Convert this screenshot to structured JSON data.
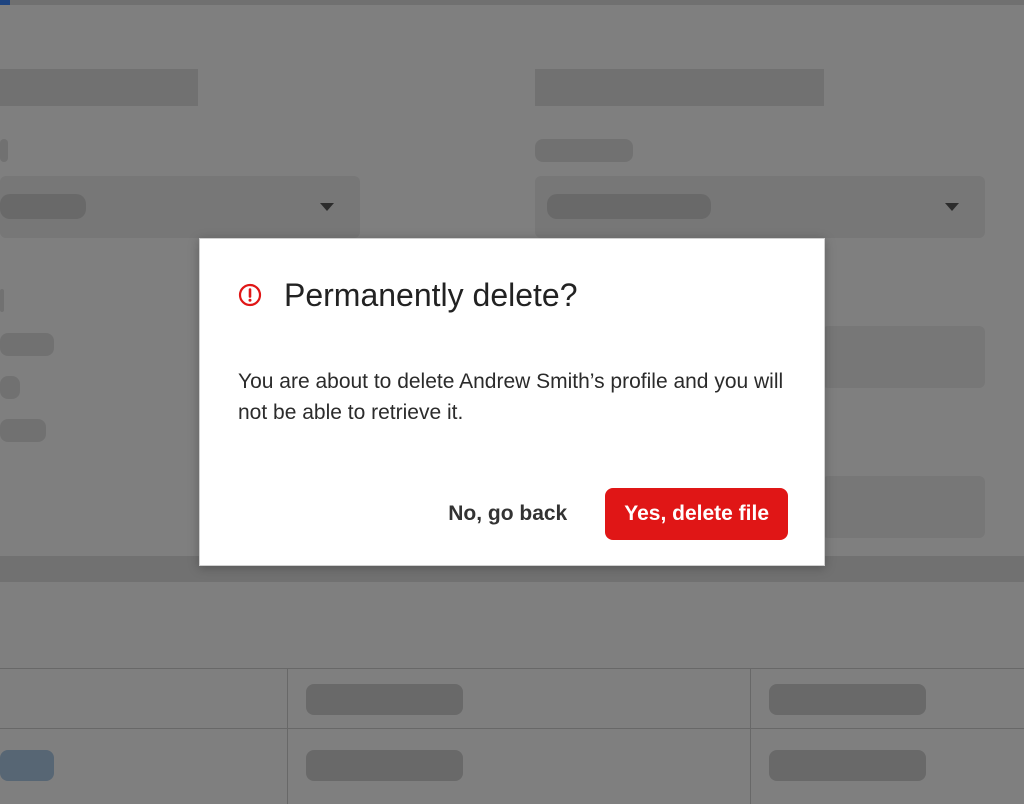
{
  "dialog": {
    "title": "Permanently delete?",
    "message": "You are about to delete Andrew Smith’s profile and you will not be able to retrieve it.",
    "cancel_label": "No, go back",
    "confirm_label": "Yes, delete file",
    "icon": "alert-circle-icon"
  },
  "colors": {
    "danger": "#e01616",
    "overlay": "rgba(0,0,0,0.48)",
    "text": "#222222"
  }
}
